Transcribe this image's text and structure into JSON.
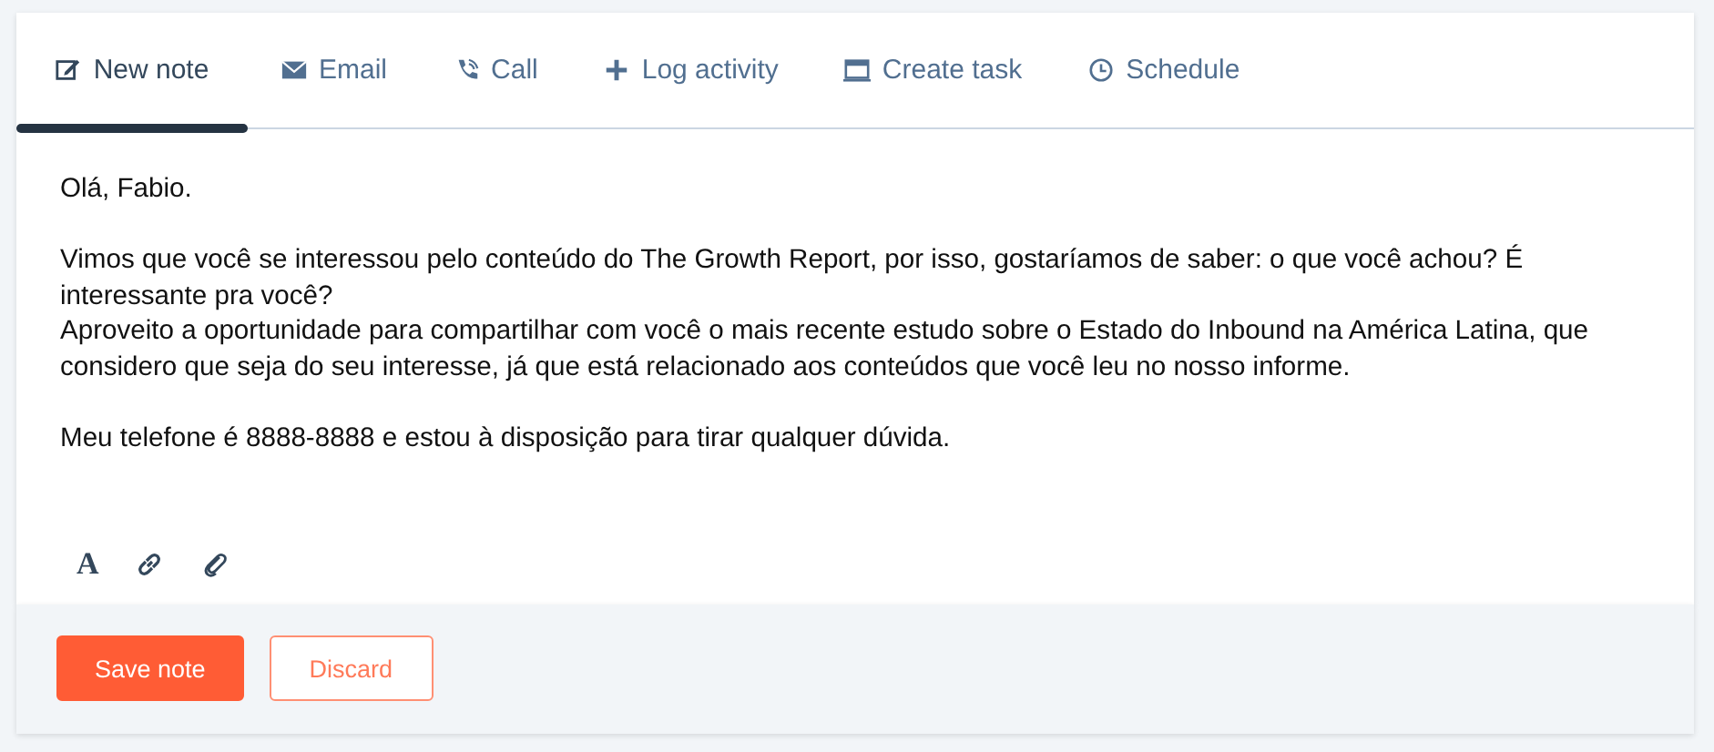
{
  "tabs": [
    {
      "kind": "edit",
      "label": "New note",
      "selected": true
    },
    {
      "kind": "mail",
      "label": "Email",
      "selected": false
    },
    {
      "kind": "phone",
      "label": "Call",
      "selected": false
    },
    {
      "kind": "plus",
      "label": "Log activity",
      "selected": false
    },
    {
      "kind": "task",
      "label": "Create task",
      "selected": false
    },
    {
      "kind": "clock",
      "label": "Schedule",
      "selected": false
    }
  ],
  "note": {
    "paragraphs": [
      [
        "Olá, Fabio."
      ],
      [
        "Vimos que você se interessou pelo conteúdo do The Growth Report, por isso, gostaríamos de saber: o que você achou? É interessante pra você?",
        "Aproveito a oportunidade para compartilhar com você o mais recente estudo sobre o Estado do Inbound na América Latina, que considero que seja do seu interesse, já que está relacionado aos conteúdos que você leu no nosso informe."
      ],
      [
        "Meu telefone é 8888-8888 e estou à disposição para tirar qualquer dúvida."
      ]
    ]
  },
  "toolbar": {
    "format_label": "A"
  },
  "buttons": [
    {
      "kind": "primary",
      "label": "Save note"
    },
    {
      "kind": "secondary",
      "label": "Discard"
    }
  ]
}
